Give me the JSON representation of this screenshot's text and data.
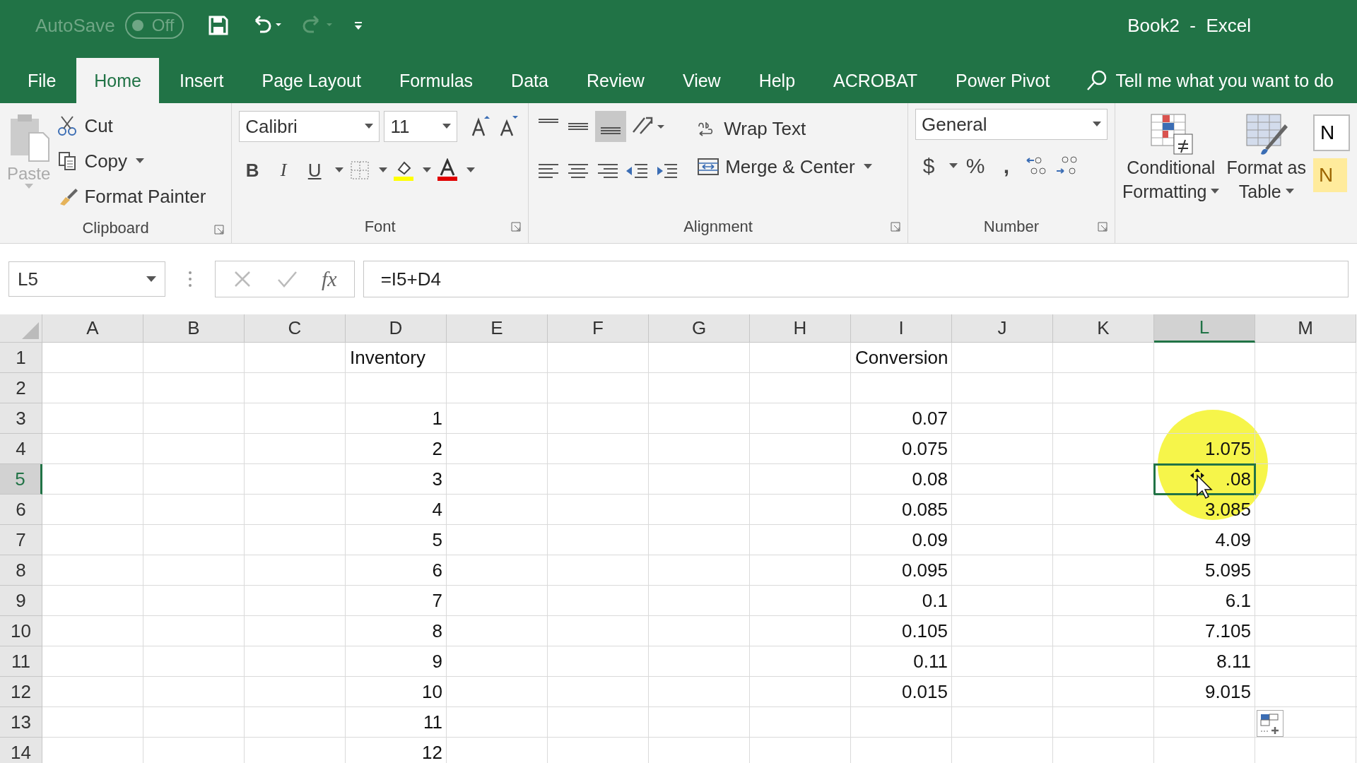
{
  "title_bar": {
    "autosave_label": "AutoSave",
    "autosave": {
      "label": "Off",
      "on": false
    },
    "title": "Book2  -  Excel"
  },
  "tabs": [
    {
      "label": "File",
      "selected": false
    },
    {
      "label": "Home",
      "selected": true
    },
    {
      "label": "Insert",
      "selected": false
    },
    {
      "label": "Page Layout",
      "selected": false
    },
    {
      "label": "Formulas",
      "selected": false
    },
    {
      "label": "Data",
      "selected": false
    },
    {
      "label": "Review",
      "selected": false
    },
    {
      "label": "View",
      "selected": false
    },
    {
      "label": "Help",
      "selected": false
    },
    {
      "label": "ACROBAT",
      "selected": false
    },
    {
      "label": "Power Pivot",
      "selected": false
    }
  ],
  "search": {
    "placeholder": "Tell me what you want to do"
  },
  "ribbon": {
    "clipboard": {
      "paste": {
        "label": "Paste",
        "disabled": true
      },
      "cut": "Cut",
      "copy": "Copy",
      "format_painter": "Format Painter",
      "label": "Clipboard"
    },
    "font": {
      "name": "Calibri",
      "size": "11",
      "bold": "B",
      "italic": "I",
      "underline": "U",
      "label": "Font"
    },
    "alignment": {
      "wrap_text": "Wrap Text",
      "merge_center": "Merge & Center",
      "label": "Alignment"
    },
    "number": {
      "format": "General",
      "currency": "$",
      "percent": "%",
      "comma": ",",
      "label": "Number"
    },
    "styles": {
      "conditional": [
        "Conditional",
        "Formatting"
      ],
      "format_table": [
        "Format as",
        "Table"
      ],
      "cell_styles": [
        "N",
        "N"
      ]
    }
  },
  "formula_bar": {
    "name_box": "L5",
    "fx": "fx",
    "formula": "=I5+D4"
  },
  "sheet": {
    "columns": [
      {
        "label": "A",
        "selected": false
      },
      {
        "label": "B",
        "selected": false
      },
      {
        "label": "C",
        "selected": false
      },
      {
        "label": "D",
        "selected": false
      },
      {
        "label": "E",
        "selected": false
      },
      {
        "label": "F",
        "selected": false
      },
      {
        "label": "G",
        "selected": false
      },
      {
        "label": "H",
        "selected": false
      },
      {
        "label": "I",
        "selected": false
      },
      {
        "label": "J",
        "selected": false
      },
      {
        "label": "K",
        "selected": false
      },
      {
        "label": "L",
        "selected": true
      },
      {
        "label": "M",
        "selected": false
      }
    ],
    "rows": [
      {
        "header": "1",
        "selected": false,
        "cells": {
          "D": {
            "value": "Inventory",
            "kind": "text",
            "selected": false
          },
          "I": {
            "value": "Conversion",
            "kind": "text",
            "selected": false
          }
        }
      },
      {
        "header": "2",
        "selected": false,
        "cells": {}
      },
      {
        "header": "3",
        "selected": false,
        "cells": {
          "D": {
            "value": "1",
            "kind": "number",
            "selected": false
          },
          "I": {
            "value": "0.07",
            "kind": "number",
            "selected": false
          }
        }
      },
      {
        "header": "4",
        "selected": false,
        "cells": {
          "D": {
            "value": "2",
            "kind": "number",
            "selected": false
          },
          "I": {
            "value": "0.075",
            "kind": "number",
            "selected": false
          },
          "L": {
            "value": "1.075",
            "kind": "number",
            "selected": false
          }
        }
      },
      {
        "header": "5",
        "selected": true,
        "cells": {
          "D": {
            "value": "3",
            "kind": "number",
            "selected": false
          },
          "I": {
            "value": "0.08",
            "kind": "number",
            "selected": false
          },
          "L": {
            "value": ".08",
            "kind": "number",
            "selected": true
          }
        }
      },
      {
        "header": "6",
        "selected": false,
        "cells": {
          "D": {
            "value": "4",
            "kind": "number",
            "selected": false
          },
          "I": {
            "value": "0.085",
            "kind": "number",
            "selected": false
          },
          "L": {
            "value": "3.085",
            "kind": "number",
            "selected": false
          }
        }
      },
      {
        "header": "7",
        "selected": false,
        "cells": {
          "D": {
            "value": "5",
            "kind": "number",
            "selected": false
          },
          "I": {
            "value": "0.09",
            "kind": "number",
            "selected": false
          },
          "L": {
            "value": "4.09",
            "kind": "number",
            "selected": false
          }
        }
      },
      {
        "header": "8",
        "selected": false,
        "cells": {
          "D": {
            "value": "6",
            "kind": "number",
            "selected": false
          },
          "I": {
            "value": "0.095",
            "kind": "number",
            "selected": false
          },
          "L": {
            "value": "5.095",
            "kind": "number",
            "selected": false
          }
        }
      },
      {
        "header": "9",
        "selected": false,
        "cells": {
          "D": {
            "value": "7",
            "kind": "number",
            "selected": false
          },
          "I": {
            "value": "0.1",
            "kind": "number",
            "selected": false
          },
          "L": {
            "value": "6.1",
            "kind": "number",
            "selected": false
          }
        }
      },
      {
        "header": "10",
        "selected": false,
        "cells": {
          "D": {
            "value": "8",
            "kind": "number",
            "selected": false
          },
          "I": {
            "value": "0.105",
            "kind": "number",
            "selected": false
          },
          "L": {
            "value": "7.105",
            "kind": "number",
            "selected": false
          }
        }
      },
      {
        "header": "11",
        "selected": false,
        "cells": {
          "D": {
            "value": "9",
            "kind": "number",
            "selected": false
          },
          "I": {
            "value": "0.11",
            "kind": "number",
            "selected": false
          },
          "L": {
            "value": "8.11",
            "kind": "number",
            "selected": false
          }
        }
      },
      {
        "header": "12",
        "selected": false,
        "cells": {
          "D": {
            "value": "10",
            "kind": "number",
            "selected": false
          },
          "I": {
            "value": "0.015",
            "kind": "number",
            "selected": false
          },
          "L": {
            "value": "9.015",
            "kind": "number",
            "selected": false
          }
        }
      },
      {
        "header": "13",
        "selected": false,
        "cells": {
          "D": {
            "value": "11",
            "kind": "number",
            "selected": false
          }
        }
      },
      {
        "header": "14",
        "selected": false,
        "cells": {
          "D": {
            "value": "12",
            "kind": "number",
            "selected": false
          }
        }
      }
    ]
  }
}
